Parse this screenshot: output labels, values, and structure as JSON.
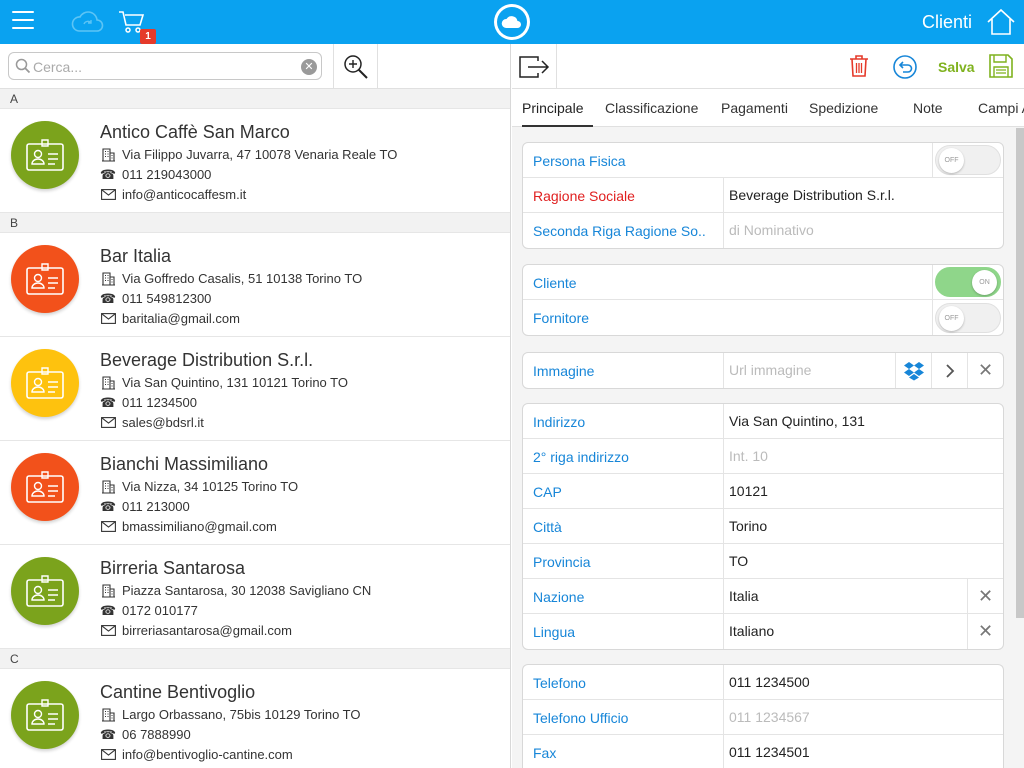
{
  "header": {
    "title": "Clienti",
    "cart_count": "1"
  },
  "search": {
    "placeholder": "Cerca...",
    "value": ""
  },
  "contacts": [
    {
      "section": "A"
    },
    {
      "name": "Antico Caffè San Marco",
      "address": "Via Filippo Juvarra, 47 10078 Venaria Reale TO",
      "phone": "011 219043000",
      "email": "info@anticocaffesm.it",
      "color": "#7ba31c"
    },
    {
      "section": "B"
    },
    {
      "name": "Bar Italia",
      "address": "Via Goffredo Casalis, 51 10138 Torino TO",
      "phone": "011 549812300",
      "email": "baritalia@gmail.com",
      "color": "#f2511b"
    },
    {
      "name": "Beverage Distribution S.r.l.",
      "address": "Via San Quintino, 131 10121 Torino TO",
      "phone": "011 1234500",
      "email": "sales@bdsrl.it",
      "color": "#fec20e"
    },
    {
      "name": "Bianchi Massimiliano",
      "address": "Via Nizza, 34 10125 Torino TO",
      "phone": "011 213000",
      "email": "bmassimiliano@gmail.com",
      "color": "#f2511b"
    },
    {
      "name": "Birreria Santarosa",
      "address": "Piazza Santarosa, 30 12038 Savigliano CN",
      "phone": "0172 010177",
      "email": "birreriasantarosa@gmail.com",
      "color": "#7ba31c"
    },
    {
      "section": "C"
    },
    {
      "name": "Cantine Bentivoglio",
      "address": "Largo Orbassano, 75bis 10129 Torino TO",
      "phone": "06 7888990",
      "email": "info@bentivoglio-cantine.com",
      "color": "#7ba31c"
    }
  ],
  "toolbar": {
    "save_label": "Salva"
  },
  "tabs": [
    {
      "label": "Principale",
      "active": true
    },
    {
      "label": "Classificazione"
    },
    {
      "label": "Pagamenti"
    },
    {
      "label": "Spedizione"
    },
    {
      "label": "Note"
    },
    {
      "label": "Campi A"
    }
  ],
  "form": {
    "persona_fisica": {
      "label": "Persona Fisica",
      "state": "OFF"
    },
    "ragione_sociale": {
      "label": "Ragione Sociale",
      "value": "Beverage Distribution S.r.l."
    },
    "seconda_riga": {
      "label": "Seconda Riga Ragione So..",
      "placeholder": "di Nominativo"
    },
    "cliente": {
      "label": "Cliente",
      "state": "ON"
    },
    "fornitore": {
      "label": "Fornitore",
      "state": "OFF"
    },
    "immagine": {
      "label": "Immagine",
      "placeholder": "Url immagine"
    },
    "indirizzo": {
      "label": "Indirizzo",
      "value": "Via San Quintino, 131"
    },
    "indirizzo2": {
      "label": "2° riga indirizzo",
      "placeholder": "Int. 10"
    },
    "cap": {
      "label": "CAP",
      "value": "10121"
    },
    "citta": {
      "label": "Città",
      "value": "Torino"
    },
    "provincia": {
      "label": "Provincia",
      "value": "TO"
    },
    "nazione": {
      "label": "Nazione",
      "value": "Italia"
    },
    "lingua": {
      "label": "Lingua",
      "value": "Italiano"
    },
    "telefono": {
      "label": "Telefono",
      "value": "011 1234500"
    },
    "telefono_ufficio": {
      "label": "Telefono Ufficio",
      "placeholder": "011 1234567"
    },
    "fax": {
      "label": "Fax",
      "value": "011 1234501"
    }
  },
  "icons": {
    "menu": "hamburger-icon",
    "cloud": "cloud-icon",
    "cart": "cart-icon",
    "home": "home-icon",
    "zoom": "zoom-in-icon",
    "exit": "exit-icon",
    "trash": "trash-icon",
    "undo": "undo-icon",
    "save": "floppy-icon",
    "dropbox": "dropbox-icon"
  },
  "colors": {
    "primary": "#0aa2f0",
    "label_blue": "#1786d8",
    "required_red": "#e02020",
    "save_green": "#7fb21e",
    "trash_red": "#e53a2a",
    "toggle_on": "#8fd68a"
  }
}
